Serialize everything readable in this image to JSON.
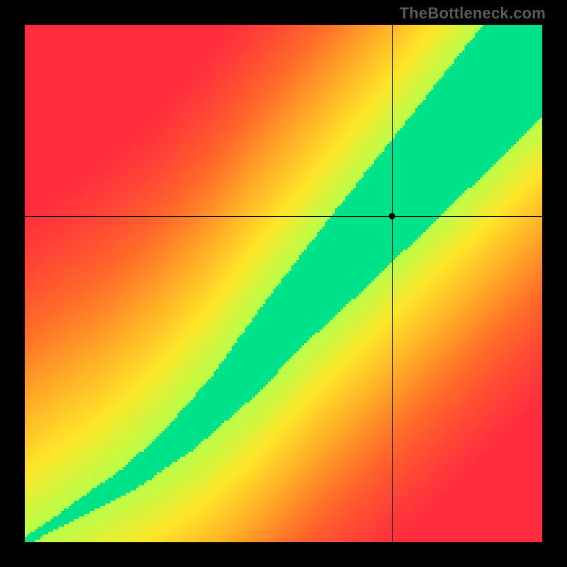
{
  "watermark": "TheBottleneck.com",
  "chart_data": {
    "type": "heatmap",
    "title": "",
    "xlabel": "",
    "ylabel": "",
    "xlim": [
      0,
      100
    ],
    "ylim": [
      0,
      100
    ],
    "crosshair": {
      "x": 71,
      "y": 63
    },
    "dot": {
      "x": 71,
      "y": 63
    },
    "ridge": [
      {
        "x": 0,
        "y": 0
      },
      {
        "x": 10,
        "y": 6
      },
      {
        "x": 20,
        "y": 12
      },
      {
        "x": 30,
        "y": 20
      },
      {
        "x": 40,
        "y": 30
      },
      {
        "x": 50,
        "y": 42
      },
      {
        "x": 60,
        "y": 53
      },
      {
        "x": 70,
        "y": 64
      },
      {
        "x": 80,
        "y": 75
      },
      {
        "x": 90,
        "y": 86
      },
      {
        "x": 100,
        "y": 97
      }
    ],
    "color_stops": [
      {
        "t": 0.0,
        "color": "#ff2b3f"
      },
      {
        "t": 0.22,
        "color": "#ff6a2a"
      },
      {
        "t": 0.42,
        "color": "#ffb027"
      },
      {
        "t": 0.6,
        "color": "#ffe62a"
      },
      {
        "t": 0.78,
        "color": "#b9ff4a"
      },
      {
        "t": 0.9,
        "color": "#3dff8a"
      },
      {
        "t": 1.0,
        "color": "#00e28a"
      }
    ],
    "green_band_half_width": 6,
    "falloff_distance": 60
  }
}
